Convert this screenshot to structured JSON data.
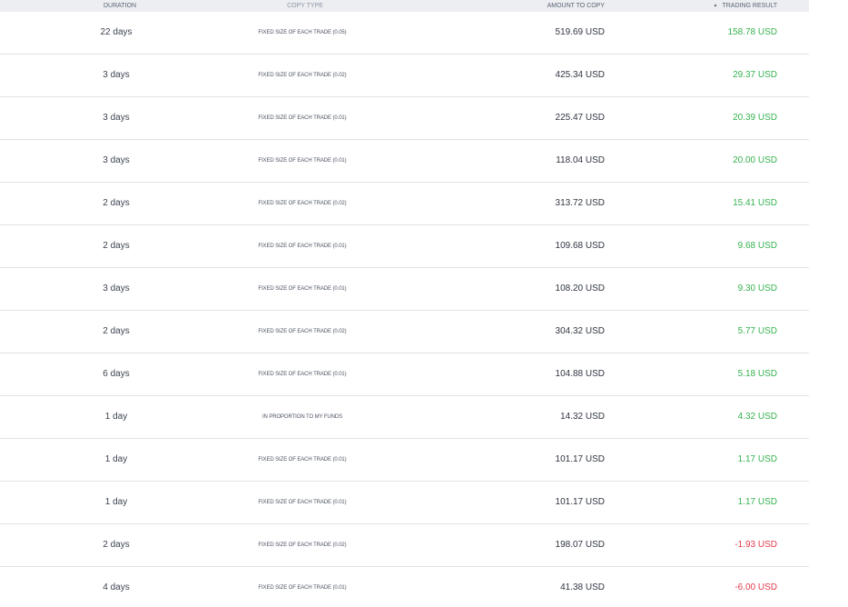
{
  "header": {
    "duration": "DURATION",
    "copy_type": "COPY TYPE",
    "amount": "AMOUNT TO COPY",
    "result": "TRADING RESULT",
    "sort_icon": "▲"
  },
  "colors": {
    "positive": "#35b24f",
    "negative": "#e23a4a",
    "header_bg": "#eceef1"
  },
  "rows": [
    {
      "duration": "22 days",
      "copy_type": "FIXED SIZE OF EACH TRADE (0.05)",
      "amount": "519.69 USD",
      "result": "158.78 USD"
    },
    {
      "duration": "3 days",
      "copy_type": "FIXED SIZE OF EACH TRADE (0.02)",
      "amount": "425.34 USD",
      "result": "29.37 USD"
    },
    {
      "duration": "3 days",
      "copy_type": "FIXED SIZE OF EACH TRADE (0.01)",
      "amount": "225.47 USD",
      "result": "20.39 USD"
    },
    {
      "duration": "3 days",
      "copy_type": "FIXED SIZE OF EACH TRADE (0.01)",
      "amount": "118.04 USD",
      "result": "20.00 USD"
    },
    {
      "duration": "2 days",
      "copy_type": "FIXED SIZE OF EACH TRADE (0.02)",
      "amount": "313.72 USD",
      "result": "15.41 USD"
    },
    {
      "duration": "2 days",
      "copy_type": "FIXED SIZE OF EACH TRADE (0.01)",
      "amount": "109.68 USD",
      "result": "9.68 USD"
    },
    {
      "duration": "3 days",
      "copy_type": "FIXED SIZE OF EACH TRADE (0.01)",
      "amount": "108.20 USD",
      "result": "9.30 USD"
    },
    {
      "duration": "2 days",
      "copy_type": "FIXED SIZE OF EACH TRADE (0.02)",
      "amount": "304.32 USD",
      "result": "5.77 USD"
    },
    {
      "duration": "6 days",
      "copy_type": "FIXED SIZE OF EACH TRADE (0.01)",
      "amount": "104.88 USD",
      "result": "5.18 USD"
    },
    {
      "duration": "1 day",
      "copy_type": "IN PROPORTION TO MY FUNDS",
      "amount": "14.32 USD",
      "result": "4.32 USD"
    },
    {
      "duration": "1 day",
      "copy_type": "FIXED SIZE OF EACH TRADE (0.01)",
      "amount": "101.17 USD",
      "result": "1.17 USD"
    },
    {
      "duration": "1 day",
      "copy_type": "FIXED SIZE OF EACH TRADE (0.01)",
      "amount": "101.17 USD",
      "result": "1.17 USD"
    },
    {
      "duration": "2 days",
      "copy_type": "FIXED SIZE OF EACH TRADE (0.02)",
      "amount": "198.07 USD",
      "result": "-1.93 USD"
    },
    {
      "duration": "4 days",
      "copy_type": "FIXED SIZE OF EACH TRADE (0.01)",
      "amount": "41.38 USD",
      "result": "-6.00 USD"
    }
  ]
}
